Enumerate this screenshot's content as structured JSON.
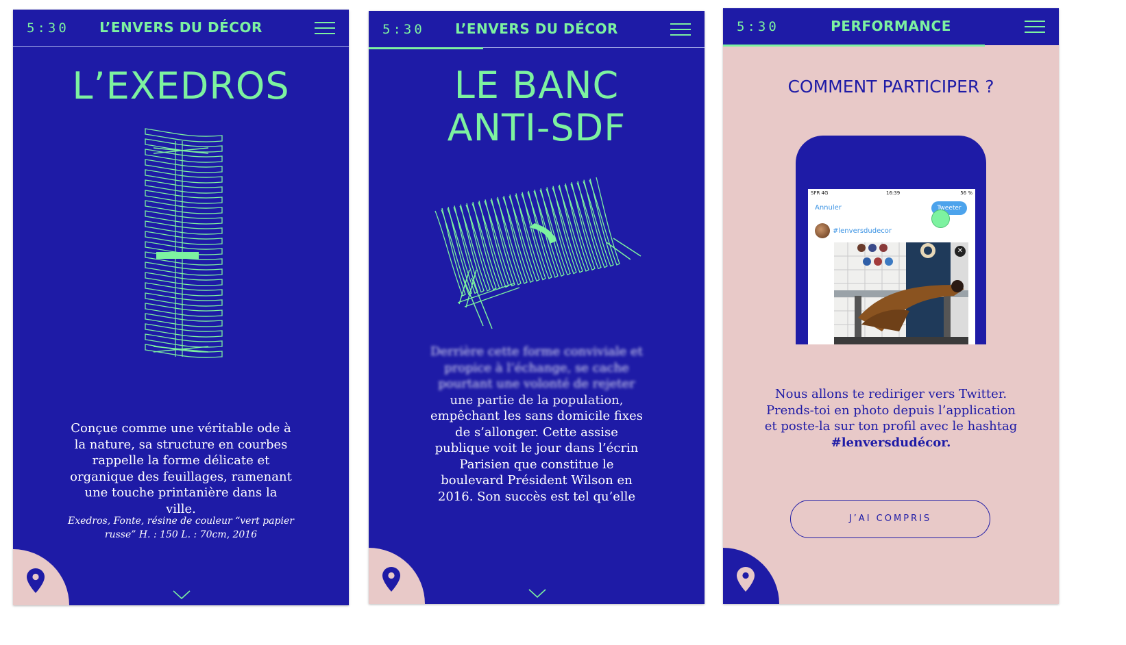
{
  "colors": {
    "navy": "#1e1ba6",
    "mint": "#7df2a0",
    "pink": "#e8c9c8",
    "white": "#ffffff"
  },
  "screens": [
    {
      "time": "5:30",
      "header_title": "L’ENVERS DU DÉCOR",
      "menu_icon": "hamburger-menu-icon",
      "title": "L’EXEDROS",
      "illustration": "exedros-bench-wireframe",
      "body": "Conçue comme une véritable ode à la nature, sa structure en courbes rappelle la forme délicate et organique des feuillages, ramenant une touche printanière dans la ville.",
      "caption": "Exedros, Fonte, résine de couleur  “vert papier russe” H. : 150 L. : 70cm, 2016",
      "location_icon": "map-pin-icon",
      "scroll_icon": "chevron-down-icon"
    },
    {
      "time": "5:30",
      "header_title": "L’ENVERS DU DÉCOR",
      "menu_icon": "hamburger-menu-icon",
      "progress": 0.34,
      "title_line1": "LE BANC",
      "title_line2": "ANTI-SDF",
      "illustration": "anti-sdf-bench-wireframe",
      "body_blurred": "Derrière cette forme conviviale et propice à l’échange, se cache pourtant une volonté de rejeter",
      "body_partial": "une partie de la population,",
      "body": "empêchant les sans domicile fixes de s’allonger. Cette assise publique voit le jour dans l’écrin Parisien que constitue le boulevard Président Wilson en 2016. Son succès est tel qu’elle",
      "location_icon": "map-pin-icon",
      "scroll_icon": "chevron-down-icon"
    },
    {
      "time": "5:30",
      "header_title": "PERFORMANCE",
      "menu_icon": "hamburger-menu-icon",
      "progress": 0.78,
      "title": "COMMENT PARTICIPER ?",
      "tweet": {
        "status_left": "SFR  4G",
        "status_time": "16:39",
        "status_right": "56 %",
        "cancel": "Annuler",
        "tweet_button": "Tweeter",
        "hashtag": "#lenversdudecor",
        "close": "✕"
      },
      "body": "Nous allons te rediriger vers Twitter. Prends-toi en photo depuis l’application et poste-la sur ton profil avec le hashtag",
      "hashtag_bold": "#lenversdudécor.",
      "button": "J’AI COMPRIS",
      "location_icon": "map-pin-icon"
    }
  ]
}
